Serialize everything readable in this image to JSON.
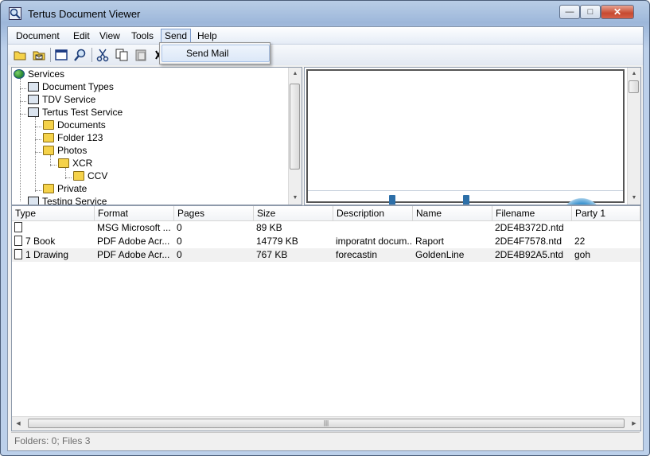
{
  "window": {
    "title": "Tertus Document Viewer",
    "minimize": "—",
    "maximize": "□",
    "close": "✕"
  },
  "menubar": {
    "items": [
      "Document",
      "Edit",
      "View",
      "Tools",
      "Send",
      "Help"
    ],
    "active": "Send"
  },
  "send_menu": {
    "items": [
      "Send Mail"
    ]
  },
  "toolbar": {
    "icons": [
      "open-folder-icon",
      "mail-icon",
      "window-icon",
      "search-icon",
      "cut-icon",
      "copy-icon",
      "paste-icon",
      "close-icon"
    ]
  },
  "tree": {
    "nodes": [
      {
        "label": "Services",
        "icon": "globe-icon",
        "level": 0
      },
      {
        "label": "Document Types",
        "icon": "document-types-icon",
        "level": 1
      },
      {
        "label": "TDV Service",
        "icon": "computer-icon",
        "level": 1
      },
      {
        "label": "Tertus Test Service",
        "icon": "computer-icon",
        "level": 1
      },
      {
        "label": "Documents",
        "icon": "folder-icon",
        "level": 2
      },
      {
        "label": "Folder 123",
        "icon": "folder-icon",
        "level": 2
      },
      {
        "label": "Photos",
        "icon": "folder-icon",
        "level": 2
      },
      {
        "label": "XCR",
        "icon": "folder-icon",
        "level": 3
      },
      {
        "label": "CCV",
        "icon": "folder-icon",
        "level": 4
      },
      {
        "label": "Private",
        "icon": "folder-icon",
        "level": 2
      },
      {
        "label": "Testing Service",
        "icon": "computer-icon",
        "level": 1
      }
    ]
  },
  "file_list": {
    "columns": [
      "Type",
      "Format",
      "Pages",
      "Size",
      "Description",
      "Name",
      "Filename",
      "Party 1"
    ],
    "rows": [
      [
        "",
        "MSG Microsoft ...",
        "0",
        "89 KB",
        "",
        "",
        "2DE4B372D.ntd",
        ""
      ],
      [
        "7 Book",
        "PDF Adobe Acr...",
        "0",
        "14779 KB",
        "imporatnt docum...",
        "Raport",
        "2DE4F7578.ntd",
        "22"
      ],
      [
        "1 Drawing",
        "PDF Adobe Acr...",
        "0",
        "767 KB",
        "forecastin",
        "GoldenLine",
        "2DE4B92A5.ntd",
        "goh"
      ]
    ]
  },
  "status": {
    "text": "Folders: 0; Files 3"
  },
  "colors": {
    "title_bar": "#b9cde6",
    "close_button": "#c74a30",
    "folder": "#f5d24a",
    "menu_highlight": "#dfe9f7"
  }
}
